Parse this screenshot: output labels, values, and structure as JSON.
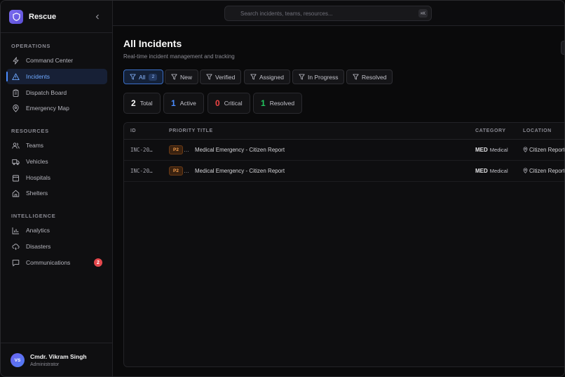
{
  "brand": {
    "name": "Rescue"
  },
  "sidebar": {
    "sections": [
      {
        "label": "OPERATIONS",
        "items": [
          {
            "label": "Command Center",
            "icon": "bolt-icon"
          },
          {
            "label": "Incidents",
            "icon": "alert-triangle-icon",
            "active": true
          },
          {
            "label": "Dispatch Board",
            "icon": "clipboard-icon"
          },
          {
            "label": "Emergency Map",
            "icon": "map-pin-icon"
          }
        ]
      },
      {
        "label": "RESOURCES",
        "items": [
          {
            "label": "Teams",
            "icon": "users-icon"
          },
          {
            "label": "Vehicles",
            "icon": "truck-icon"
          },
          {
            "label": "Hospitals",
            "icon": "hospital-icon"
          },
          {
            "label": "Shelters",
            "icon": "home-icon"
          }
        ]
      },
      {
        "label": "INTELLIGENCE",
        "items": [
          {
            "label": "Analytics",
            "icon": "bar-chart-icon"
          },
          {
            "label": "Disasters",
            "icon": "cloud-icon"
          },
          {
            "label": "Communications",
            "icon": "message-icon",
            "badge": "2"
          }
        ]
      }
    ]
  },
  "user": {
    "initials": "VS",
    "name": "Cmdr. Vikram Singh",
    "role": "Administrator"
  },
  "search": {
    "placeholder": "Search incidents, teams, resources...",
    "shortcut": "⌘K"
  },
  "page": {
    "title": "All Incidents",
    "subtitle": "Real-time incident management and tracking"
  },
  "filters": [
    {
      "label": "All",
      "count": "2",
      "active": true
    },
    {
      "label": "New"
    },
    {
      "label": "Verified"
    },
    {
      "label": "Assigned"
    },
    {
      "label": "In Progress"
    },
    {
      "label": "Resolved"
    }
  ],
  "stats": [
    {
      "value": "2",
      "label": "Total",
      "color": "#fafafa"
    },
    {
      "value": "1",
      "label": "Active",
      "color": "#4a8cff"
    },
    {
      "value": "0",
      "label": "Critical",
      "color": "#ef4444"
    },
    {
      "value": "1",
      "label": "Resolved",
      "color": "#22c55e"
    }
  ],
  "table": {
    "headers": {
      "id": "ID",
      "priority_title": "PRIORITY TITLE",
      "category": "CATEGORY",
      "location": "LOCATION"
    },
    "rows": [
      {
        "id": "INC-20…",
        "priority": "P2",
        "priority_more": "…",
        "title": "Medical Emergency - Citizen Report",
        "category_code": "MED",
        "category_name": "Medical",
        "location": "Citizen Report"
      },
      {
        "id": "INC-20…",
        "priority": "P2",
        "priority_more": "…",
        "title": "Medical Emergency - Citizen Report",
        "category_code": "MED",
        "category_name": "Medical",
        "location": "Citizen Report"
      }
    ]
  },
  "colors": {
    "accent": "#4a8cff",
    "danger": "#ef4444",
    "success": "#22c55e",
    "priority": "#f59e4b"
  }
}
